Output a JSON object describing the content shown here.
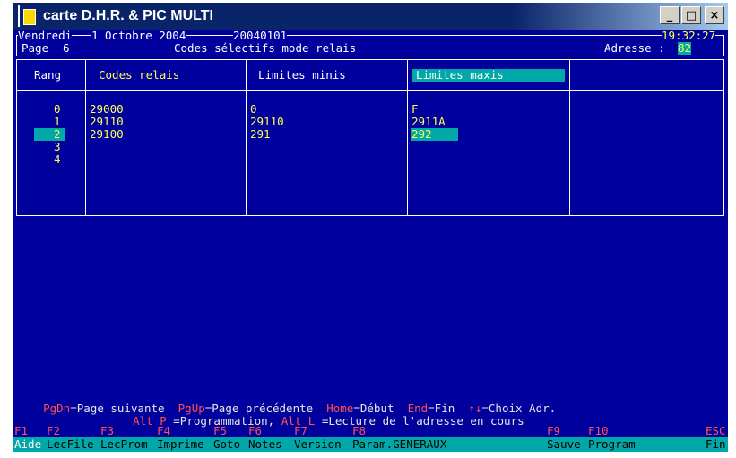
{
  "window": {
    "title": "carte D.H.R. & PIC MULTI",
    "minimize": "_",
    "maximize": "□",
    "close": "×"
  },
  "header": {
    "day": "Vendredi",
    "date": "1 Octobre 2004",
    "code": "20040101",
    "time": "19:32:27",
    "page_label": "Page",
    "page_number": "6",
    "screen_title": "Codes sélectifs mode relais",
    "address_label": "Adresse :",
    "address_value": "82"
  },
  "table": {
    "columns": [
      "Rang",
      "Codes relais",
      "Limites minis",
      "Limites maxis"
    ],
    "rang": [
      "0",
      "1",
      "2",
      "3",
      "4"
    ],
    "selected_rang": "2",
    "codes_relais": [
      "29000",
      "29110",
      "29100"
    ],
    "limites_minis": [
      "0",
      "29110",
      "291"
    ],
    "limites_maxis": [
      "F",
      "2911A",
      "292"
    ]
  },
  "help": {
    "line1": [
      {
        "key": "PgDn",
        "text": "=Page suivante"
      },
      {
        "key": "PgUp",
        "text": "=Page précédente"
      },
      {
        "key": "Home",
        "text": "=Début"
      },
      {
        "key": "End",
        "text": "=Fin"
      },
      {
        "key": "↑↓",
        "text": "=Choix Adr."
      }
    ],
    "line2": [
      {
        "key": "Alt P",
        "text": " =Programmation, "
      },
      {
        "key": "Alt L",
        "text": " =Lecture de l'adresse en cours"
      }
    ]
  },
  "function_keys": [
    "F1",
    "F2",
    "F3",
    "F4",
    "F5",
    "F6",
    "F7",
    "F8",
    "F9",
    "F10",
    "ESC"
  ],
  "function_labels": [
    "Aide",
    "LecFile",
    "LecProm",
    "Imprime",
    "Goto",
    "Notes",
    "Version",
    "Param.GENERAUX",
    "Sauve",
    "Program",
    "Fin"
  ]
}
